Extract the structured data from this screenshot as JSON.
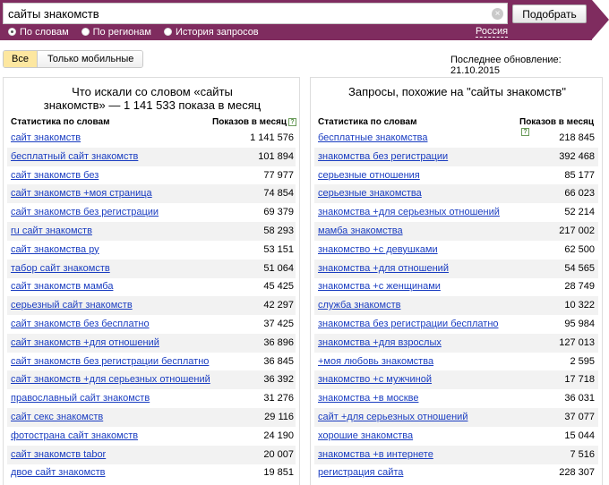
{
  "search": {
    "query": "сайты знакомств",
    "clear_glyph": "×",
    "submit_label": "Подобрать"
  },
  "modes": [
    {
      "label": "По словам",
      "checked": true
    },
    {
      "label": "По регионам",
      "checked": false
    },
    {
      "label": "История запросов",
      "checked": false
    }
  ],
  "region": "Россия",
  "filter": {
    "all_label": "Все",
    "mobile_label": "Только мобильные"
  },
  "last_update": "Последнее обновление: 21.10.2015",
  "left_panel": {
    "title_line1": "Что искали со словом «сайты",
    "title_line2": "знакомств» — 1 141 533 показа в месяц",
    "col_keyword": "Статистика по словам",
    "col_shows": "Показов в месяц",
    "help_glyph": "?",
    "rows": [
      {
        "kw": "сайт знакомств",
        "count": "1 141 576"
      },
      {
        "kw": "бесплатный сайт знакомств",
        "count": "101 894"
      },
      {
        "kw": "сайт знакомств без",
        "count": "77 977"
      },
      {
        "kw": "сайт знакомств +моя страница",
        "count": "74 854"
      },
      {
        "kw": "сайт знакомств без регистрации",
        "count": "69 379"
      },
      {
        "kw": "ru сайт знакомств",
        "count": "58 293"
      },
      {
        "kw": "сайт знакомства ру",
        "count": "53 151"
      },
      {
        "kw": "табор сайт знакомств",
        "count": "51 064"
      },
      {
        "kw": "сайт знакомств мамба",
        "count": "45 425"
      },
      {
        "kw": "серьезный сайт знакомств",
        "count": "42 297"
      },
      {
        "kw": "сайт знакомств без бесплатно",
        "count": "37 425"
      },
      {
        "kw": "сайт знакомств +для отношений",
        "count": "36 896"
      },
      {
        "kw": "сайт знакомств без регистрации бесплатно",
        "count": "36 845"
      },
      {
        "kw": "сайт знакомств +для серьезных отношений",
        "count": "36 392"
      },
      {
        "kw": "православный сайт знакомств",
        "count": "31 276"
      },
      {
        "kw": "сайт секс знакомств",
        "count": "29 116"
      },
      {
        "kw": "фотострана сайт знакомств",
        "count": "24 190"
      },
      {
        "kw": "сайт знакомств tabor",
        "count": "20 007"
      },
      {
        "kw": "двое сайт знакомств",
        "count": "19 851"
      }
    ]
  },
  "right_panel": {
    "title": "Запросы, похожие на \"сайты знакомств\"",
    "col_keyword": "Статистика по словам",
    "col_shows": "Показов в месяц",
    "help_glyph": "?",
    "rows": [
      {
        "kw": "бесплатные знакомства",
        "count": "218 845"
      },
      {
        "kw": "знакомства без регистрации",
        "count": "392 468"
      },
      {
        "kw": "серьезные отношения",
        "count": "85 177"
      },
      {
        "kw": "серьезные знакомства",
        "count": "66 023"
      },
      {
        "kw": "знакомства +для серьезных отношений",
        "count": "52 214"
      },
      {
        "kw": "мамба знакомства",
        "count": "217 002"
      },
      {
        "kw": "знакомство +с девушками",
        "count": "62 500"
      },
      {
        "kw": "знакомства +для отношений",
        "count": "54 565"
      },
      {
        "kw": "знакомства +с женщинами",
        "count": "28 749"
      },
      {
        "kw": "служба знакомств",
        "count": "10 322"
      },
      {
        "kw": "знакомства без регистрации бесплатно",
        "count": "95 984"
      },
      {
        "kw": "знакомства +для взрослых",
        "count": "127 013"
      },
      {
        "kw": "+моя любовь знакомства",
        "count": "2 595"
      },
      {
        "kw": "знакомство +с мужчиной",
        "count": "17 718"
      },
      {
        "kw": "знакомства +в москве",
        "count": "36 031"
      },
      {
        "kw": "сайт +для серьезных отношений",
        "count": "37 077"
      },
      {
        "kw": "хорошие знакомства",
        "count": "15 044"
      },
      {
        "kw": "знакомства +в интернете",
        "count": "7 516"
      },
      {
        "kw": "регистрация сайта",
        "count": "228 307"
      }
    ]
  },
  "colors": {
    "topbar": "#7f2c5f",
    "link": "#1a3dc1",
    "active_filter": "#fde7a0",
    "row_shade": "#f2f2f2"
  }
}
